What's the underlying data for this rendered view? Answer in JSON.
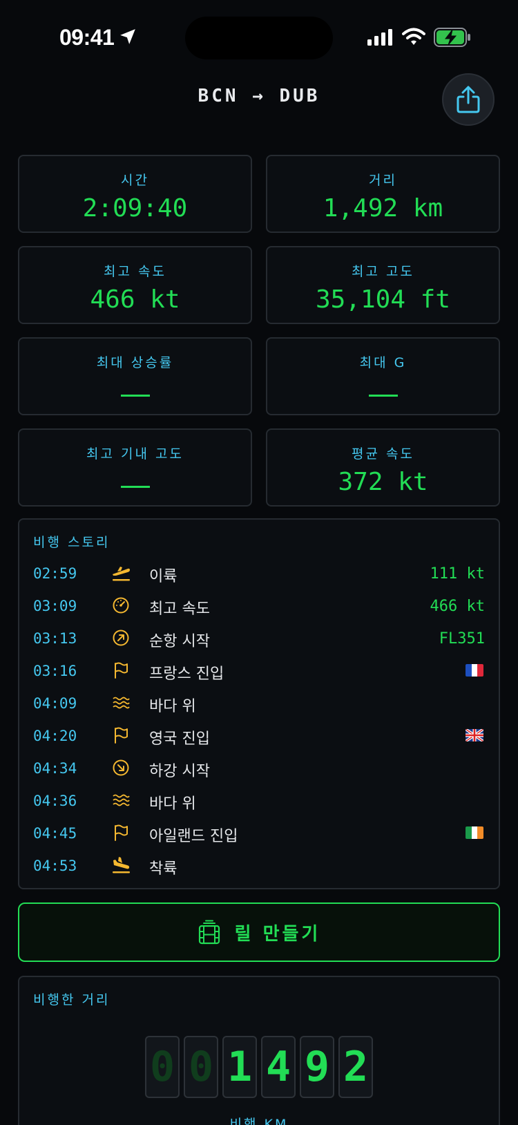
{
  "status_bar": {
    "time": "09:41"
  },
  "header": {
    "route": "BCN → DUB"
  },
  "stats": [
    {
      "label": "시간",
      "value": "2:09:40"
    },
    {
      "label": "거리",
      "value": "1,492 km"
    },
    {
      "label": "최고 속도",
      "value": "466 kt"
    },
    {
      "label": "최고 고도",
      "value": "35,104 ft"
    },
    {
      "label": "최대 상승률",
      "value": ""
    },
    {
      "label": "최대 G",
      "value": ""
    },
    {
      "label": "최고 기내 고도",
      "value": ""
    },
    {
      "label": "평균 속도",
      "value": "372 kt"
    }
  ],
  "story": {
    "title": "비행 스토리",
    "events": [
      {
        "time": "02:59",
        "icon": "takeoff-icon",
        "label": "이륙",
        "value": "111 kt"
      },
      {
        "time": "03:09",
        "icon": "speedometer-icon",
        "label": "최고 속도",
        "value": "466 kt"
      },
      {
        "time": "03:13",
        "icon": "arrow-up-right-icon",
        "label": "순항 시작",
        "value": "FL351"
      },
      {
        "time": "03:16",
        "icon": "flag-icon",
        "label": "프랑스 진입",
        "flag": "france-flag-icon"
      },
      {
        "time": "04:09",
        "icon": "waves-icon",
        "label": "바다 위"
      },
      {
        "time": "04:20",
        "icon": "flag-icon",
        "label": "영국 진입",
        "flag": "uk-flag-icon"
      },
      {
        "time": "04:34",
        "icon": "arrow-down-right-icon",
        "label": "하강 시작"
      },
      {
        "time": "04:36",
        "icon": "waves-icon",
        "label": "바다 위"
      },
      {
        "time": "04:45",
        "icon": "flag-icon",
        "label": "아일랜드 진입",
        "flag": "ireland-flag-icon"
      },
      {
        "time": "04:53",
        "icon": "landing-icon",
        "label": "착륙"
      }
    ]
  },
  "reel_button": {
    "label": "릴 만들기"
  },
  "distance": {
    "title": "비행한 거리",
    "digits": [
      "0",
      "0",
      "1",
      "4",
      "9",
      "2"
    ],
    "caption": "비행 KM"
  },
  "colors": {
    "accent_green": "#22dd55",
    "accent_cyan": "#45c8f0",
    "icon_amber": "#f5b830",
    "background": "#07090c"
  }
}
